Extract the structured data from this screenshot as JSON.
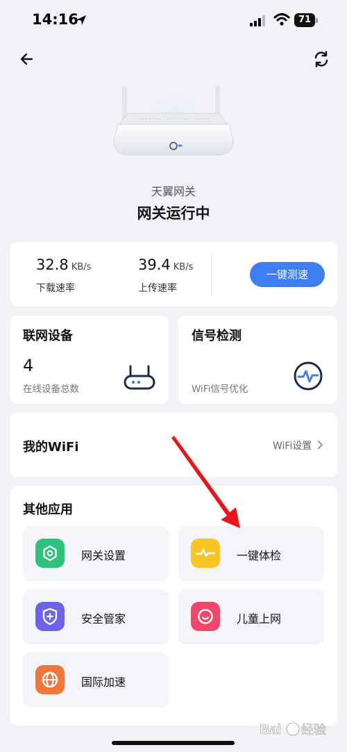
{
  "status_bar": {
    "time": "14:16",
    "battery": "71"
  },
  "header": {
    "gateway_name": "天翼网关",
    "gateway_status": "网关运行中"
  },
  "speed": {
    "download_value": "32.8",
    "download_unit": "KB/s",
    "download_label": "下载速率",
    "upload_value": "39.4",
    "upload_unit": "KB/s",
    "upload_label": "上传速率",
    "test_button": "一键测速"
  },
  "devices": {
    "title": "联网设备",
    "count": "4",
    "subtitle": "在线设备总数"
  },
  "signal": {
    "title": "信号检测",
    "subtitle": "WiFi信号优化"
  },
  "wifi": {
    "title": "我的WiFi",
    "settings_link": "WiFi设置"
  },
  "apps": {
    "title": "其他应用",
    "items": [
      {
        "label": "网关设置",
        "icon": "hexagon-settings-icon",
        "color": "#2ec27e"
      },
      {
        "label": "一键体检",
        "icon": "pulse-check-icon",
        "color": "#f8c525"
      },
      {
        "label": "安全管家",
        "icon": "shield-plus-icon",
        "color": "#6c63e8"
      },
      {
        "label": "儿童上网",
        "icon": "smile-face-icon",
        "color": "#f0486a"
      },
      {
        "label": "国际加速",
        "icon": "globe-icon",
        "color": "#f2773c"
      }
    ]
  },
  "colors": {
    "accent": "#3f7df2",
    "background": "#f2f3f7",
    "annotation_arrow": "#e8161b"
  },
  "watermark": {
    "text": "Bai度 经验"
  }
}
